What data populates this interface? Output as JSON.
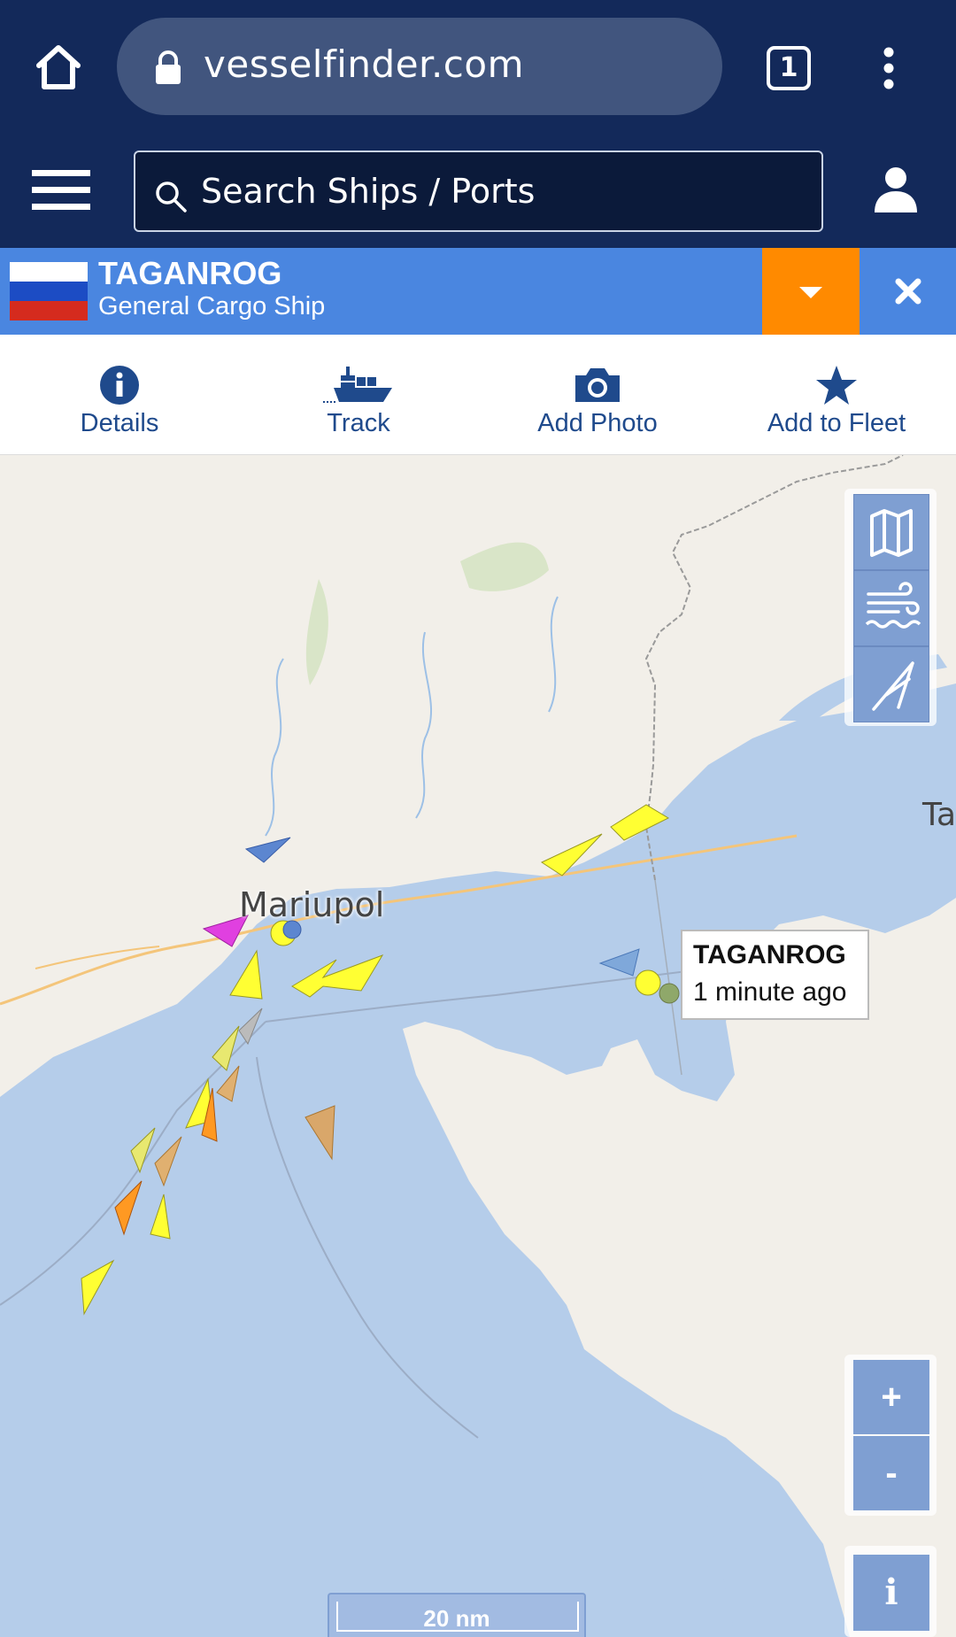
{
  "browser": {
    "url": "vesselfinder.com",
    "tab_count": "1"
  },
  "header": {
    "search_placeholder": "Search Ships  /  Ports"
  },
  "vessel": {
    "name": "TAGANROG",
    "type": "General Cargo Ship",
    "flag": "russia-flag"
  },
  "actions": [
    {
      "label": "Details",
      "icon": "info-icon"
    },
    {
      "label": "Track",
      "icon": "ship-icon"
    },
    {
      "label": "Add Photo",
      "icon": "camera-icon"
    },
    {
      "label": "Add to Fleet",
      "icon": "star-icon"
    }
  ],
  "map": {
    "city": "Mariupol",
    "edge_label": "Ta",
    "tooltip": {
      "name": "TAGANROG",
      "time": "1 minute ago"
    },
    "scale": "20 nm",
    "zoom_in": "+",
    "zoom_out": "-",
    "info": "i"
  },
  "colors": {
    "nav_bg": "#13295a",
    "banner_bg": "#4a86e0",
    "dropdown_bg": "#ff8a00",
    "sea": "#b5cdea",
    "land": "#f2efe9",
    "action_text": "#1f4a8c",
    "control_btn": "#7f9fd2"
  }
}
